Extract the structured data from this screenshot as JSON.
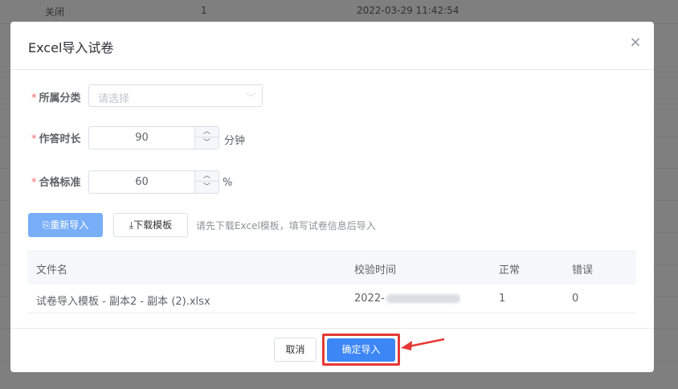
{
  "background": {
    "row": {
      "status": "关闭",
      "count": "1",
      "time": "2022-03-29 11:42:54"
    }
  },
  "modal": {
    "title": "Excel导入试卷",
    "close_icon": "×",
    "category": {
      "label": "所属分类",
      "placeholder": "请选择"
    },
    "duration": {
      "label": "作答时长",
      "value": "90",
      "unit": "分钟"
    },
    "pass_score": {
      "label": "合格标准",
      "value": "60",
      "unit": "%"
    },
    "required_mark": "*",
    "reimport_button": "重新导入",
    "download_button": "下载模板",
    "hint": "请先下载Excel模板，填写试卷信息后导入",
    "table": {
      "headers": [
        "文件名",
        "校验时间",
        "正常",
        "错误"
      ],
      "rows": [
        {
          "file": "试卷导入模板 - 副本2 - 副本 (2).xlsx",
          "time": "2022-",
          "ok": "1",
          "error": "0"
        }
      ]
    },
    "cancel_button": "取消",
    "confirm_button": "确定导入"
  },
  "colors": {
    "primary": "#3d86f6",
    "primary_light": "#79aef8",
    "required": "#f56c6c",
    "highlight": "#e53935"
  },
  "icons": [
    "close-icon",
    "chevron-down-icon",
    "chevron-up-icon",
    "import-icon",
    "download-icon",
    "arrow-annotation-icon"
  ]
}
